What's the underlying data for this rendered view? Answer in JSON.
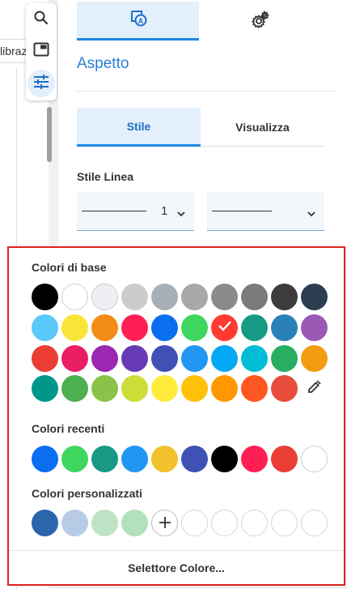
{
  "background": {
    "partial_label": "librazi"
  },
  "toolbar": {
    "items": [
      {
        "icon": "search-icon"
      },
      {
        "icon": "picture-in-picture-icon"
      },
      {
        "icon": "sliders-icon",
        "active": true
      }
    ]
  },
  "panel": {
    "top_tabs": [
      {
        "icon": "text-style-icon",
        "active": true
      },
      {
        "icon": "gear-icon",
        "active": false
      }
    ],
    "title": "Aspetto",
    "sub_tabs": [
      {
        "label": "Stile",
        "active": true
      },
      {
        "label": "Visualizza",
        "active": false
      }
    ],
    "line_style_label": "Stile Linea",
    "line_thickness_value": "1"
  },
  "color_popup": {
    "basic_label": "Colori di base",
    "basic_colors": [
      [
        "#000000",
        "#ffffff",
        "#eeeef4",
        "#cccccc",
        "#a8afb7",
        "#a8a8a8",
        "#8b8b8b",
        "#7b7b7b",
        "#3c3c3c",
        "#2c3e50"
      ],
      [
        "#5ac8fa",
        "#f9e43a",
        "#f28c14",
        "#ff1f55",
        "#0a6ef0",
        "#3fd65f",
        "#ff3b30",
        "#169a83",
        "#2a80b9",
        "#9b59b6"
      ],
      [
        "#ea3e35",
        "#e91e63",
        "#9c27b0",
        "#673ab7",
        "#3f51b5",
        "#2196f3",
        "#03a9f4",
        "#00bcd4",
        "#27ae60",
        "#f39c12"
      ],
      [
        "#009688",
        "#4caf50",
        "#8bc34a",
        "#cddc39",
        "#ffeb3b",
        "#ffc107",
        "#ff9800",
        "#ff5722",
        "#e74c3c"
      ]
    ],
    "selected_color": "#ff3b30",
    "eyedropper_icon": "eyedropper-icon",
    "recent_label": "Colori recenti",
    "recent_colors": [
      "#0a6ef0",
      "#3fd65f",
      "#169a83",
      "#2196f3",
      "#f2c12e",
      "#3f51b5",
      "#000000",
      "#ff1f55",
      "#ea3e35",
      "#ffffff"
    ],
    "custom_label": "Colori personalizzati",
    "custom_colors": [
      "#2a65ad",
      "#b7cbe6",
      "#bee3c4",
      "#b2e2bb"
    ],
    "custom_empty_slots": 5,
    "add_icon": "plus-icon",
    "picker_label": "Selettore Colore...",
    "accent": "#1e88e5",
    "highlight_border": "#e02020"
  }
}
